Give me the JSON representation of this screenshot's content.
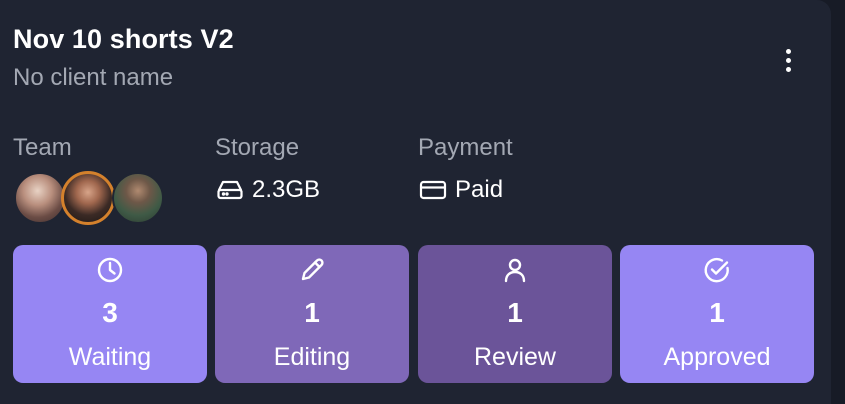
{
  "card": {
    "title": "Nov 10 shorts V2",
    "subtitle": "No client name"
  },
  "meta": {
    "team_label": "Team",
    "storage_label": "Storage",
    "storage_value": "2.3GB",
    "storage_icon": "hard-drive-icon",
    "payment_label": "Payment",
    "payment_value": "Paid",
    "payment_icon": "credit-card-icon"
  },
  "team": {
    "members": [
      {
        "name": "team-member-1"
      },
      {
        "name": "team-member-2"
      },
      {
        "name": "team-member-3"
      }
    ]
  },
  "statuses": [
    {
      "key": "waiting",
      "label": "Waiting",
      "count": "3",
      "icon": "clock-icon",
      "color": "#9686f3"
    },
    {
      "key": "editing",
      "label": "Editing",
      "count": "1",
      "icon": "pencil-icon",
      "color": "#7f68b8"
    },
    {
      "key": "review",
      "label": "Review",
      "count": "1",
      "icon": "user-icon",
      "color": "#6b5499"
    },
    {
      "key": "approved",
      "label": "Approved",
      "count": "1",
      "icon": "check-circle-icon",
      "color": "#9686f3"
    }
  ],
  "colors": {
    "background": "#171b26",
    "card": "#1f2432",
    "muted_text": "#a3a8b3",
    "avatar_ring": "#d4812c"
  }
}
